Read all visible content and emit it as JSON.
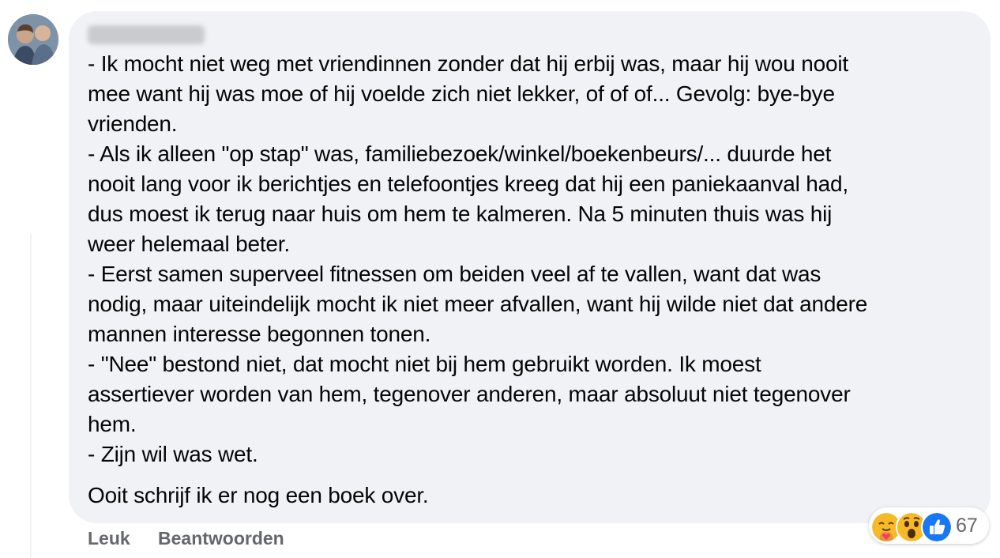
{
  "comment": {
    "lines": [
      "- Ik mocht niet weg met vriendinnen zonder dat hij erbij was, maar hij wou nooit",
      "mee want hij was moe of hij voelde zich niet lekker, of of of... Gevolg: bye-bye",
      "vrienden.",
      "- Als ik alleen \"op stap\" was, familiebezoek/winkel/boekenbeurs/... duurde het",
      "nooit lang voor ik berichtjes en telefoontjes kreeg dat hij een paniekaanval had,",
      "dus moest ik terug naar huis om hem te kalmeren. Na 5 minuten thuis was hij",
      "weer helemaal beter.",
      "- Eerst samen superveel fitnessen om beiden veel af te vallen, want dat was",
      "nodig, maar uiteindelijk mocht ik niet meer afvallen, want hij wilde niet dat andere",
      "mannen interesse begonnen tonen.",
      "- \"Nee\" bestond niet, dat mocht niet bij hem gebruikt worden. Ik moest",
      "assertiever worden van hem, tegenover anderen, maar absoluut niet tegenover",
      "hem.",
      "- Zijn wil was wet."
    ],
    "final_paragraph": "Ooit schrijf ik er nog een boek over."
  },
  "actions": {
    "like_label": "Leuk",
    "reply_label": "Beantwoorden"
  },
  "reactions": {
    "icons": [
      "care-emoji-icon",
      "wow-emoji-icon",
      "like-thumb-icon"
    ],
    "count": "67"
  },
  "colors": {
    "bubble": "#f0f2f5",
    "action_text": "#65676b",
    "like_blue": "#1877f2",
    "emoji_yellow": "#f7b928"
  }
}
